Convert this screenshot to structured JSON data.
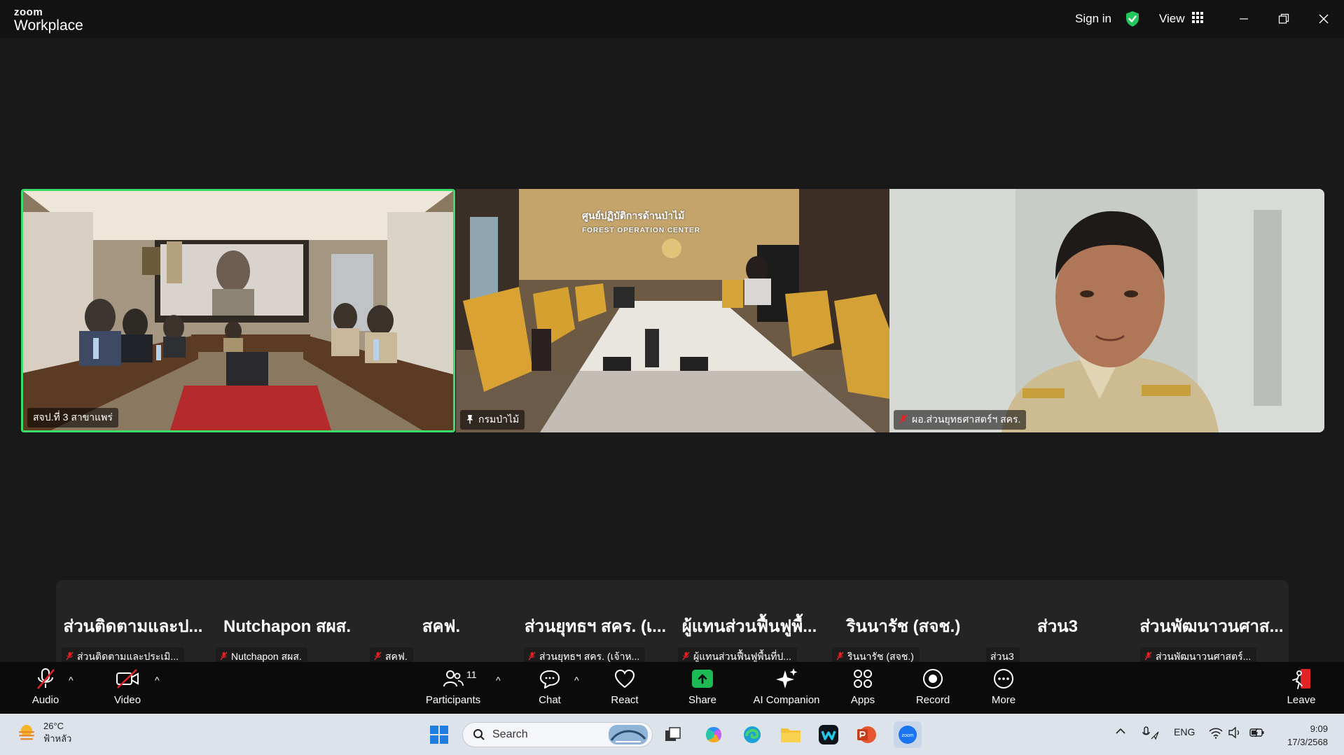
{
  "titlebar": {
    "logo_top": "zoom",
    "logo_bottom": "Workplace",
    "sign_in": "Sign in",
    "view": "View",
    "shield_icon": "shield-check-icon",
    "shield_color": "#22c55e"
  },
  "tiles": [
    {
      "name": "สจป.ที่ 3 สาขาแพร่",
      "muted": false,
      "pinned": false,
      "active_speaker": true
    },
    {
      "name": "กรมป่าไม้",
      "muted": false,
      "pinned": true,
      "active_speaker": false
    },
    {
      "name": "ผอ.ส่วนยุทธศาสตร์ฯ สคร.",
      "muted": true,
      "pinned": false,
      "active_speaker": false
    }
  ],
  "tile2_sign": "ศูนย์ปฏิบัติการด้านป่าไม้",
  "tile2_sign_en": "FOREST OPERATION CENTER",
  "strip": [
    {
      "big": "ส่วนติดตามและป...",
      "small": "ส่วนติดตามและประเมิ...",
      "muted": true
    },
    {
      "big": "Nutchapon สผส.",
      "small": "Nutchapon สผส.",
      "muted": true
    },
    {
      "big": "สคฟ.",
      "small": "สคฟ.",
      "muted": true
    },
    {
      "big": "ส่วนยุทธฯ สคร. (เ...",
      "small": "ส่วนยุทธฯ สคร. (เจ้าห...",
      "muted": true
    },
    {
      "big": "ผู้แทนส่วนฟื้นฟูพื้...",
      "small": "ผู้แทนส่วนฟื้นฟูพื้นที่ป...",
      "muted": true
    },
    {
      "big": "รินนารัช (สจช.)",
      "small": "รินนารัช (สจช.)",
      "muted": true
    },
    {
      "big": "ส่วน3",
      "small": "ส่วน3",
      "muted": false
    },
    {
      "big": "ส่วนพัฒนาวนศาส...",
      "small": "ส่วนพัฒนาวนศาสตร์...",
      "muted": true
    }
  ],
  "toolbar": {
    "audio": "Audio",
    "video": "Video",
    "participants": "Participants",
    "participants_count": "11",
    "chat": "Chat",
    "react": "React",
    "share": "Share",
    "ai": "AI Companion",
    "apps": "Apps",
    "record": "Record",
    "more": "More",
    "leave": "Leave",
    "share_color": "#1db954",
    "leave_color": "#e02424"
  },
  "taskbar": {
    "temp": "26°C",
    "weather_desc": "ฟ้าหลัว",
    "search": "Search",
    "lang": "ENG",
    "time": "9:09",
    "date": "17/3/2568"
  }
}
